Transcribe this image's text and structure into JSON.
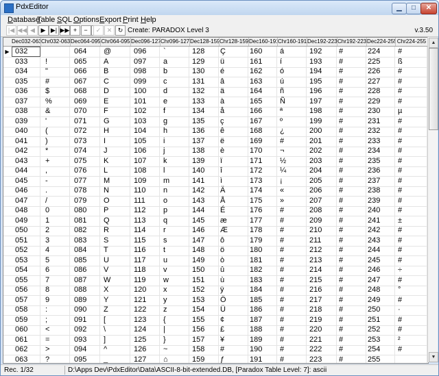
{
  "window": {
    "title": "PdxEditor"
  },
  "menu": [
    {
      "label": "Database",
      "u": "D",
      "rest": "atabase"
    },
    {
      "label": "Table",
      "u": "T",
      "rest": "able"
    },
    {
      "label": "SQL",
      "u": "S",
      "rest": "QL"
    },
    {
      "label": "Options",
      "u": "O",
      "rest": "ptions"
    },
    {
      "label": "Export",
      "u": "E",
      "rest": "xport"
    },
    {
      "label": "Print",
      "u": "P",
      "rest": "rint"
    },
    {
      "label": "Help",
      "u": "H",
      "rest": "elp"
    }
  ],
  "toolbar": {
    "buttons": [
      {
        "icon": "first-record-icon",
        "glyph": "|◀",
        "enabled": false
      },
      {
        "icon": "prior-page-icon",
        "glyph": "◀◀",
        "enabled": false
      },
      {
        "icon": "prior-record-icon",
        "glyph": "◀",
        "enabled": false
      },
      {
        "icon": "next-record-icon",
        "glyph": "▶",
        "enabled": true
      },
      {
        "icon": "next-page-icon",
        "glyph": "▶|",
        "enabled": true
      },
      {
        "icon": "last-record-icon",
        "glyph": "▶▶",
        "enabled": true
      },
      {
        "icon": "insert-icon",
        "glyph": "+",
        "enabled": true
      },
      {
        "icon": "delete-icon",
        "glyph": "−",
        "enabled": true
      },
      {
        "icon": "edit-icon",
        "glyph": "▲",
        "enabled": true
      },
      {
        "icon": "post-icon",
        "glyph": "✓",
        "enabled": false
      },
      {
        "icon": "cancel-icon",
        "glyph": "✕",
        "enabled": false
      },
      {
        "icon": "refresh-icon",
        "glyph": "↻",
        "enabled": true
      }
    ],
    "create_text": "Create: PARADOX Level 3",
    "version": "v.3.50"
  },
  "grid": {
    "columns": [
      "Dec032-063",
      "Chr032-063",
      "Dec064-095",
      "Chr064-095",
      "Dec096-127",
      "Chr096-127",
      "Dec128-159",
      "Chr128-159",
      "Dec160-191",
      "Chr160-191",
      "Dec192-223",
      "Chr192-223",
      "Dec224-255",
      "Chr224-255"
    ],
    "rows": [
      [
        "032",
        "",
        "064",
        "@",
        "096",
        "`",
        "128",
        "Ç",
        "160",
        "á",
        "192",
        "#",
        "224",
        "#"
      ],
      [
        "033",
        "!",
        "065",
        "A",
        "097",
        "a",
        "129",
        "ü",
        "161",
        "í",
        "193",
        "#",
        "225",
        "ß"
      ],
      [
        "034",
        "\"",
        "066",
        "B",
        "098",
        "b",
        "130",
        "é",
        "162",
        "ó",
        "194",
        "#",
        "226",
        "#"
      ],
      [
        "035",
        "#",
        "067",
        "C",
        "099",
        "c",
        "131",
        "â",
        "163",
        "ú",
        "195",
        "#",
        "227",
        "#"
      ],
      [
        "036",
        "$",
        "068",
        "D",
        "100",
        "d",
        "132",
        "ä",
        "164",
        "ñ",
        "196",
        "#",
        "228",
        "#"
      ],
      [
        "037",
        "%",
        "069",
        "E",
        "101",
        "e",
        "133",
        "à",
        "165",
        "Ñ",
        "197",
        "#",
        "229",
        "#"
      ],
      [
        "038",
        "&",
        "070",
        "F",
        "102",
        "f",
        "134",
        "å",
        "166",
        "ª",
        "198",
        "#",
        "230",
        "µ"
      ],
      [
        "039",
        "'",
        "071",
        "G",
        "103",
        "g",
        "135",
        "ç",
        "167",
        "º",
        "199",
        "#",
        "231",
        "#"
      ],
      [
        "040",
        "(",
        "072",
        "H",
        "104",
        "h",
        "136",
        "ê",
        "168",
        "¿",
        "200",
        "#",
        "232",
        "#"
      ],
      [
        "041",
        ")",
        "073",
        "I",
        "105",
        "i",
        "137",
        "ë",
        "169",
        "#",
        "201",
        "#",
        "233",
        "#"
      ],
      [
        "042",
        "*",
        "074",
        "J",
        "106",
        "j",
        "138",
        "è",
        "170",
        "¬",
        "202",
        "#",
        "234",
        "#"
      ],
      [
        "043",
        "+",
        "075",
        "K",
        "107",
        "k",
        "139",
        "ï",
        "171",
        "½",
        "203",
        "#",
        "235",
        "#"
      ],
      [
        "044",
        ",",
        "076",
        "L",
        "108",
        "l",
        "140",
        "î",
        "172",
        "¼",
        "204",
        "#",
        "236",
        "#"
      ],
      [
        "045",
        "-",
        "077",
        "M",
        "109",
        "m",
        "141",
        "ì",
        "173",
        "¡",
        "205",
        "#",
        "237",
        "#"
      ],
      [
        "046",
        ".",
        "078",
        "N",
        "110",
        "n",
        "142",
        "Ä",
        "174",
        "«",
        "206",
        "#",
        "238",
        "#"
      ],
      [
        "047",
        "/",
        "079",
        "O",
        "111",
        "o",
        "143",
        "Å",
        "175",
        "»",
        "207",
        "#",
        "239",
        "#"
      ],
      [
        "048",
        "0",
        "080",
        "P",
        "112",
        "p",
        "144",
        "É",
        "176",
        "#",
        "208",
        "#",
        "240",
        "#"
      ],
      [
        "049",
        "1",
        "081",
        "Q",
        "113",
        "q",
        "145",
        "æ",
        "177",
        "#",
        "209",
        "#",
        "241",
        "±"
      ],
      [
        "050",
        "2",
        "082",
        "R",
        "114",
        "r",
        "146",
        "Æ",
        "178",
        "#",
        "210",
        "#",
        "242",
        "#"
      ],
      [
        "051",
        "3",
        "083",
        "S",
        "115",
        "s",
        "147",
        "ô",
        "179",
        "#",
        "211",
        "#",
        "243",
        "#"
      ],
      [
        "052",
        "4",
        "084",
        "T",
        "116",
        "t",
        "148",
        "ö",
        "180",
        "#",
        "212",
        "#",
        "244",
        "#"
      ],
      [
        "053",
        "5",
        "085",
        "U",
        "117",
        "u",
        "149",
        "ò",
        "181",
        "#",
        "213",
        "#",
        "245",
        "#"
      ],
      [
        "054",
        "6",
        "086",
        "V",
        "118",
        "v",
        "150",
        "û",
        "182",
        "#",
        "214",
        "#",
        "246",
        "÷"
      ],
      [
        "055",
        "7",
        "087",
        "W",
        "119",
        "w",
        "151",
        "ù",
        "183",
        "#",
        "215",
        "#",
        "247",
        "#"
      ],
      [
        "056",
        "8",
        "088",
        "X",
        "120",
        "x",
        "152",
        "ÿ",
        "184",
        "#",
        "216",
        "#",
        "248",
        "°"
      ],
      [
        "057",
        "9",
        "089",
        "Y",
        "121",
        "y",
        "153",
        "Ö",
        "185",
        "#",
        "217",
        "#",
        "249",
        "#"
      ],
      [
        "058",
        ":",
        "090",
        "Z",
        "122",
        "z",
        "154",
        "Ü",
        "186",
        "#",
        "218",
        "#",
        "250",
        "·"
      ],
      [
        "059",
        ";",
        "091",
        "[",
        "123",
        "{",
        "155",
        "¢",
        "187",
        "#",
        "219",
        "#",
        "251",
        "#"
      ],
      [
        "060",
        "<",
        "092",
        "\\",
        "124",
        "|",
        "156",
        "£",
        "188",
        "#",
        "220",
        "#",
        "252",
        "#"
      ],
      [
        "061",
        "=",
        "093",
        "]",
        "125",
        "}",
        "157",
        "¥",
        "189",
        "#",
        "221",
        "#",
        "253",
        "²"
      ],
      [
        "062",
        ">",
        "094",
        "^",
        "126",
        "~",
        "158",
        "#",
        "190",
        "#",
        "222",
        "#",
        "254",
        "#"
      ],
      [
        "063",
        "?",
        "095",
        "_",
        "127",
        "⌂",
        "159",
        "ƒ",
        "191",
        "#",
        "223",
        "#",
        "255",
        ""
      ]
    ]
  },
  "status": {
    "record": "Rec. 1/32",
    "path": "D:\\Apps Dev\\PdxEditor\\Data\\ASCII-8-bit-extended.DB, [Paradox Table Level: 7]: ascii"
  }
}
